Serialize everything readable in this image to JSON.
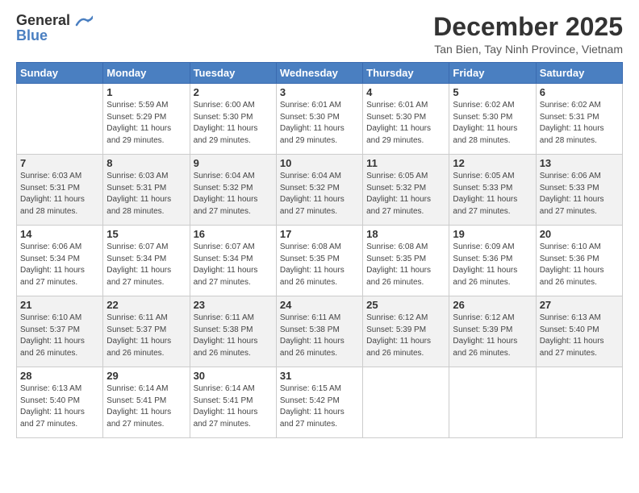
{
  "header": {
    "logo_line1": "General",
    "logo_line2": "Blue",
    "month": "December 2025",
    "location": "Tan Bien, Tay Ninh Province, Vietnam"
  },
  "weekdays": [
    "Sunday",
    "Monday",
    "Tuesday",
    "Wednesday",
    "Thursday",
    "Friday",
    "Saturday"
  ],
  "weeks": [
    [
      {
        "day": "",
        "info": ""
      },
      {
        "day": "1",
        "info": "Sunrise: 5:59 AM\nSunset: 5:29 PM\nDaylight: 11 hours\nand 29 minutes."
      },
      {
        "day": "2",
        "info": "Sunrise: 6:00 AM\nSunset: 5:30 PM\nDaylight: 11 hours\nand 29 minutes."
      },
      {
        "day": "3",
        "info": "Sunrise: 6:01 AM\nSunset: 5:30 PM\nDaylight: 11 hours\nand 29 minutes."
      },
      {
        "day": "4",
        "info": "Sunrise: 6:01 AM\nSunset: 5:30 PM\nDaylight: 11 hours\nand 29 minutes."
      },
      {
        "day": "5",
        "info": "Sunrise: 6:02 AM\nSunset: 5:30 PM\nDaylight: 11 hours\nand 28 minutes."
      },
      {
        "day": "6",
        "info": "Sunrise: 6:02 AM\nSunset: 5:31 PM\nDaylight: 11 hours\nand 28 minutes."
      }
    ],
    [
      {
        "day": "7",
        "info": "Sunrise: 6:03 AM\nSunset: 5:31 PM\nDaylight: 11 hours\nand 28 minutes."
      },
      {
        "day": "8",
        "info": "Sunrise: 6:03 AM\nSunset: 5:31 PM\nDaylight: 11 hours\nand 28 minutes."
      },
      {
        "day": "9",
        "info": "Sunrise: 6:04 AM\nSunset: 5:32 PM\nDaylight: 11 hours\nand 27 minutes."
      },
      {
        "day": "10",
        "info": "Sunrise: 6:04 AM\nSunset: 5:32 PM\nDaylight: 11 hours\nand 27 minutes."
      },
      {
        "day": "11",
        "info": "Sunrise: 6:05 AM\nSunset: 5:32 PM\nDaylight: 11 hours\nand 27 minutes."
      },
      {
        "day": "12",
        "info": "Sunrise: 6:05 AM\nSunset: 5:33 PM\nDaylight: 11 hours\nand 27 minutes."
      },
      {
        "day": "13",
        "info": "Sunrise: 6:06 AM\nSunset: 5:33 PM\nDaylight: 11 hours\nand 27 minutes."
      }
    ],
    [
      {
        "day": "14",
        "info": "Sunrise: 6:06 AM\nSunset: 5:34 PM\nDaylight: 11 hours\nand 27 minutes."
      },
      {
        "day": "15",
        "info": "Sunrise: 6:07 AM\nSunset: 5:34 PM\nDaylight: 11 hours\nand 27 minutes."
      },
      {
        "day": "16",
        "info": "Sunrise: 6:07 AM\nSunset: 5:34 PM\nDaylight: 11 hours\nand 27 minutes."
      },
      {
        "day": "17",
        "info": "Sunrise: 6:08 AM\nSunset: 5:35 PM\nDaylight: 11 hours\nand 26 minutes."
      },
      {
        "day": "18",
        "info": "Sunrise: 6:08 AM\nSunset: 5:35 PM\nDaylight: 11 hours\nand 26 minutes."
      },
      {
        "day": "19",
        "info": "Sunrise: 6:09 AM\nSunset: 5:36 PM\nDaylight: 11 hours\nand 26 minutes."
      },
      {
        "day": "20",
        "info": "Sunrise: 6:10 AM\nSunset: 5:36 PM\nDaylight: 11 hours\nand 26 minutes."
      }
    ],
    [
      {
        "day": "21",
        "info": "Sunrise: 6:10 AM\nSunset: 5:37 PM\nDaylight: 11 hours\nand 26 minutes."
      },
      {
        "day": "22",
        "info": "Sunrise: 6:11 AM\nSunset: 5:37 PM\nDaylight: 11 hours\nand 26 minutes."
      },
      {
        "day": "23",
        "info": "Sunrise: 6:11 AM\nSunset: 5:38 PM\nDaylight: 11 hours\nand 26 minutes."
      },
      {
        "day": "24",
        "info": "Sunrise: 6:11 AM\nSunset: 5:38 PM\nDaylight: 11 hours\nand 26 minutes."
      },
      {
        "day": "25",
        "info": "Sunrise: 6:12 AM\nSunset: 5:39 PM\nDaylight: 11 hours\nand 26 minutes."
      },
      {
        "day": "26",
        "info": "Sunrise: 6:12 AM\nSunset: 5:39 PM\nDaylight: 11 hours\nand 26 minutes."
      },
      {
        "day": "27",
        "info": "Sunrise: 6:13 AM\nSunset: 5:40 PM\nDaylight: 11 hours\nand 27 minutes."
      }
    ],
    [
      {
        "day": "28",
        "info": "Sunrise: 6:13 AM\nSunset: 5:40 PM\nDaylight: 11 hours\nand 27 minutes."
      },
      {
        "day": "29",
        "info": "Sunrise: 6:14 AM\nSunset: 5:41 PM\nDaylight: 11 hours\nand 27 minutes."
      },
      {
        "day": "30",
        "info": "Sunrise: 6:14 AM\nSunset: 5:41 PM\nDaylight: 11 hours\nand 27 minutes."
      },
      {
        "day": "31",
        "info": "Sunrise: 6:15 AM\nSunset: 5:42 PM\nDaylight: 11 hours\nand 27 minutes."
      },
      {
        "day": "",
        "info": ""
      },
      {
        "day": "",
        "info": ""
      },
      {
        "day": "",
        "info": ""
      }
    ]
  ]
}
